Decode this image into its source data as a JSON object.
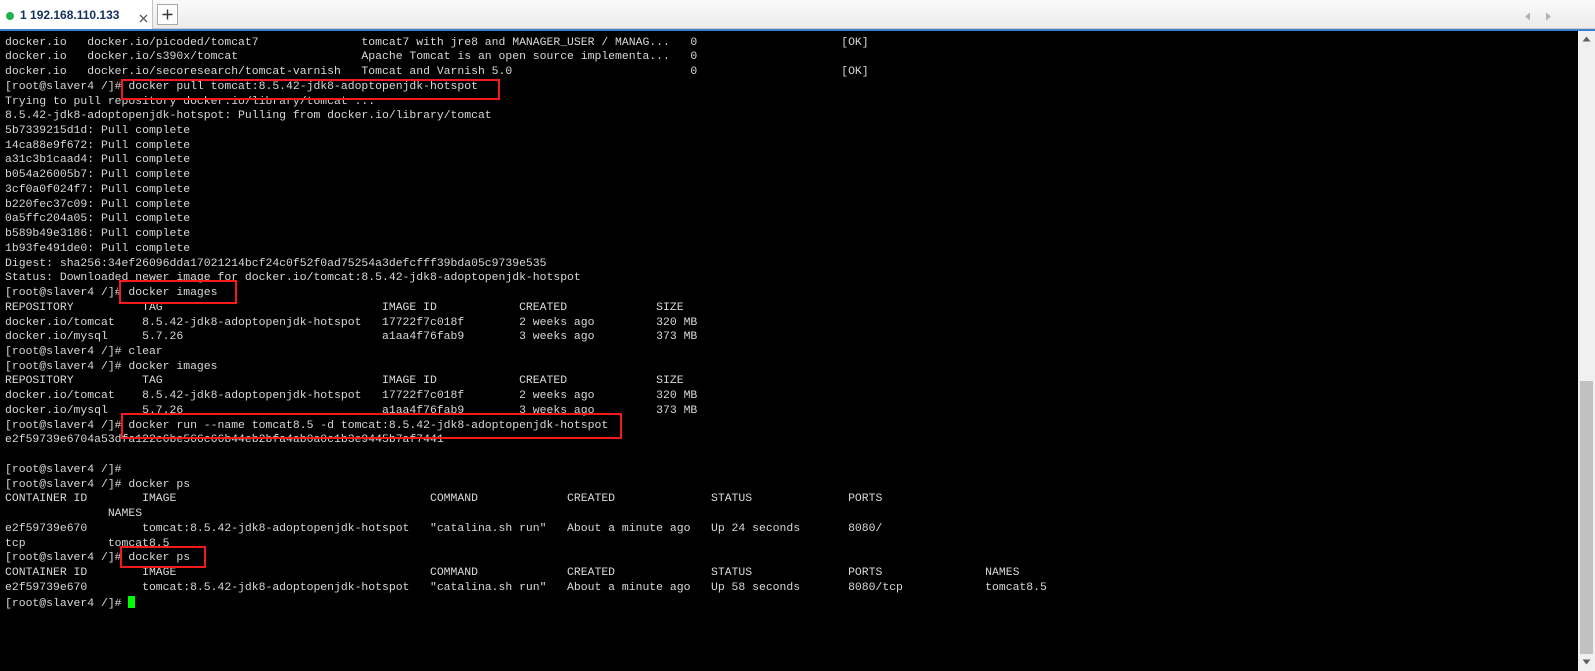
{
  "tab_bar": {
    "active_tab": {
      "number": "1",
      "host": "192.168.110.133",
      "status_color": "#1fb14c",
      "status_icon": "connected-status-icon",
      "close_icon": "close-icon"
    },
    "new_tab_icon": "plus-icon",
    "scroll_left_icon": "chevron-left-icon",
    "scroll_right_icon": "chevron-right-icon",
    "accent_color": "#3b7fd4"
  },
  "terminal": {
    "foreground": "#d9d9d9",
    "background": "#000000",
    "cursor_color": "#00ff00",
    "lines": [
      "docker.io   docker.io/picoded/tomcat7               tomcat7 with jre8 and MANAGER_USER / MANAG...   0                     [OK]",
      "docker.io   docker.io/s390x/tomcat                  Apache Tomcat is an open source implementa...   0",
      "docker.io   docker.io/secoresearch/tomcat-varnish   Tomcat and Varnish 5.0                          0                     [OK]",
      "[root@slaver4 /]# docker pull tomcat:8.5.42-jdk8-adoptopenjdk-hotspot",
      "Trying to pull repository docker.io/library/tomcat ...",
      "8.5.42-jdk8-adoptopenjdk-hotspot: Pulling from docker.io/library/tomcat",
      "5b7339215d1d: Pull complete",
      "14ca88e9f672: Pull complete",
      "a31c3b1caad4: Pull complete",
      "b054a26005b7: Pull complete",
      "3cf0a0f024f7: Pull complete",
      "b220fec37c09: Pull complete",
      "0a5ffc204a05: Pull complete",
      "b589b49e3186: Pull complete",
      "1b93fe491de0: Pull complete",
      "Digest: sha256:34ef26096dda17021214bcf24c0f52f0ad75254a3defcfff39bda05c9739e535",
      "Status: Downloaded newer image for docker.io/tomcat:8.5.42-jdk8-adoptopenjdk-hotspot",
      "[root@slaver4 /]# docker images",
      "REPOSITORY          TAG                                IMAGE ID            CREATED             SIZE",
      "docker.io/tomcat    8.5.42-jdk8-adoptopenjdk-hotspot   17722f7c018f        2 weeks ago         320 MB",
      "docker.io/mysql     5.7.26                             a1aa4f76fab9        3 weeks ago         373 MB",
      "[root@slaver4 /]# clear",
      "[root@slaver4 /]# docker images",
      "REPOSITORY          TAG                                IMAGE ID            CREATED             SIZE",
      "docker.io/tomcat    8.5.42-jdk8-adoptopenjdk-hotspot   17722f7c018f        2 weeks ago         320 MB",
      "docker.io/mysql     5.7.26                             a1aa4f76fab9        3 weeks ago         373 MB",
      "[root@slaver4 /]# docker run --name tomcat8.5 -d tomcat:8.5.42-jdk8-adoptopenjdk-hotspot",
      "e2f59739e6704a53dfa122c6be566c66b44eb2bfa4ab0a0c1b3e9445b7af7441",
      "",
      "[root@slaver4 /]#",
      "[root@slaver4 /]# docker ps",
      "CONTAINER ID        IMAGE                                     COMMAND             CREATED              STATUS              PORTS",
      "               NAMES",
      "e2f59739e670        tomcat:8.5.42-jdk8-adoptopenjdk-hotspot   \"catalina.sh run\"   About a minute ago   Up 24 seconds       8080/",
      "tcp            tomcat8.5",
      "[root@slaver4 /]# docker ps",
      "CONTAINER ID        IMAGE                                     COMMAND             CREATED              STATUS              PORTS               NAMES",
      "e2f59739e670        tomcat:8.5.42-jdk8-adoptopenjdk-hotspot   \"catalina.sh run\"   About a minute ago   Up 58 seconds       8080/tcp            tomcat8.5",
      "[root@slaver4 /]# "
    ]
  },
  "annotations": {
    "color": "#f21a1a"
  },
  "scrollbar": {
    "up_icon": "arrow-up-icon",
    "down_icon": "arrow-down-icon",
    "visible_fraction": 0.45,
    "scroll_position": 1.0
  }
}
